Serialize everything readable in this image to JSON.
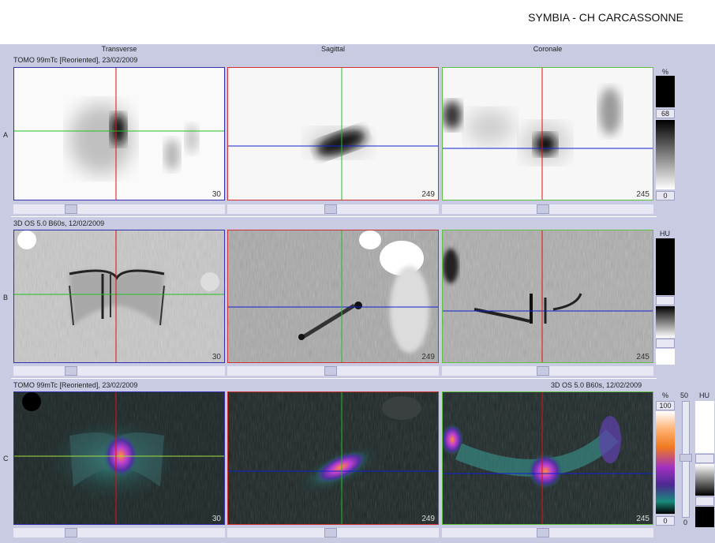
{
  "header": {
    "title": "SYMBIA - CH CARCASSONNE"
  },
  "columns": [
    "Transverse",
    "Sagittal",
    "Coronale"
  ],
  "rows": [
    {
      "label": "A",
      "info": "TOMO 99mTc [Reoriented], 23/02/2009",
      "slices": [
        "30",
        "249",
        "245"
      ]
    },
    {
      "label": "B",
      "info": "3D  OS  5.0  B60s, 12/02/2009",
      "slices": [
        "30",
        "249",
        "245"
      ]
    },
    {
      "label": "C",
      "info": "TOMO 99mTc [Reoriented], 23/02/2009",
      "info_right": "3D  OS  5.0  B60s, 12/02/2009",
      "slices": [
        "30",
        "249",
        "245"
      ]
    }
  ],
  "colorbars": {
    "a": {
      "unit": "%",
      "max": "68",
      "min": "0"
    },
    "b": {
      "unit": "HU"
    },
    "c": {
      "unit": "%",
      "max": "100",
      "min": "0",
      "slider_label": "50",
      "unit2": "HU",
      "slider_min": "0"
    }
  },
  "colors": {
    "crosshair_vertical": "#e01010",
    "crosshair_h_transverse": "#20c020",
    "crosshair_h_other": "#1020d0",
    "border_transverse": "#3030b0",
    "border_sagittal": "#d03030",
    "border_coronal": "#60c040"
  }
}
